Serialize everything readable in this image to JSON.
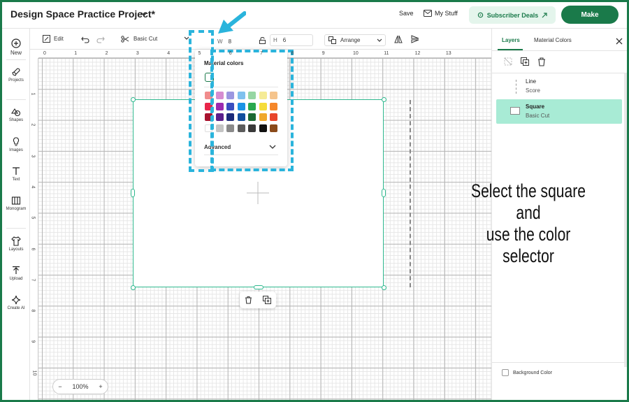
{
  "header": {
    "project_title": "Design Space Practice Project*",
    "save_label": "Save",
    "my_stuff_label": "My Stuff",
    "subscriber_deals_label": "Subscriber Deals",
    "make_label": "Make"
  },
  "left_toolbar": {
    "items": [
      {
        "label": "New",
        "icon": "plus-circle-icon"
      },
      {
        "label": "Projects",
        "icon": "rocket-icon"
      },
      {
        "label": "Shapes",
        "icon": "shapes-icon"
      },
      {
        "label": "Images",
        "icon": "lightbulb-icon"
      },
      {
        "label": "Text",
        "icon": "text-icon"
      },
      {
        "label": "Monogram",
        "icon": "monogram-icon"
      },
      {
        "label": "Layouts",
        "icon": "shirt-icon"
      },
      {
        "label": "Upload",
        "icon": "upload-icon"
      },
      {
        "label": "Create AI",
        "icon": "sparkle-icon"
      }
    ]
  },
  "top_toolbar": {
    "edit_label": "Edit",
    "operation_value": "Basic Cut",
    "width_label": "W",
    "width_value": "8",
    "height_label": "H",
    "height_value": "6",
    "arrange_label": "Arrange"
  },
  "rulers": {
    "horizontal": [
      "0",
      "1",
      "2",
      "3",
      "4",
      "5",
      "6",
      "7",
      "8",
      "9",
      "10",
      "11",
      "12",
      "13"
    ],
    "vertical": [
      "1",
      "2",
      "3",
      "4",
      "5",
      "6",
      "7",
      "8",
      "9",
      "10"
    ]
  },
  "color_popup": {
    "title": "Material colors",
    "advanced_label": "Advanced",
    "swatches": [
      [
        "#f08c8c",
        "#d58cd0",
        "#9b97e0",
        "#7fc1ee",
        "#96d6a3",
        "#f5eb96",
        "#f5c48c"
      ],
      [
        "#e8264a",
        "#9b2bb0",
        "#3a4fc0",
        "#1b94e6",
        "#2aa84f",
        "#f5dc3a",
        "#f5872a"
      ],
      [
        "#a8122e",
        "#5a1f8c",
        "#1b2a7a",
        "#124f9e",
        "#1c6a34",
        "#f0a82a",
        "#e8452a"
      ],
      [
        "#ffffff",
        "#c4c4c4",
        "#8a8a8a",
        "#5c5c5c",
        "#3a3a3a",
        "#111111",
        "#8a4a1a"
      ]
    ]
  },
  "canvas": {
    "zoom_value": "100%",
    "zoom_out": "−",
    "zoom_in": "+"
  },
  "layers_panel": {
    "tab_layers": "Layers",
    "tab_material_colors": "Material Colors",
    "layers": [
      {
        "name": "Line",
        "type": "Score"
      },
      {
        "name": "Square",
        "type": "Basic Cut"
      }
    ],
    "background_color_label": "Background Color"
  },
  "annotation": {
    "line1": "Select the square and",
    "line2": "use the color selector"
  },
  "colors": {
    "brand_green": "#1a7a4a",
    "selection": "#2fb88e",
    "highlight_dash": "#2ab4dc",
    "layer_selected": "#a8ebd5"
  }
}
